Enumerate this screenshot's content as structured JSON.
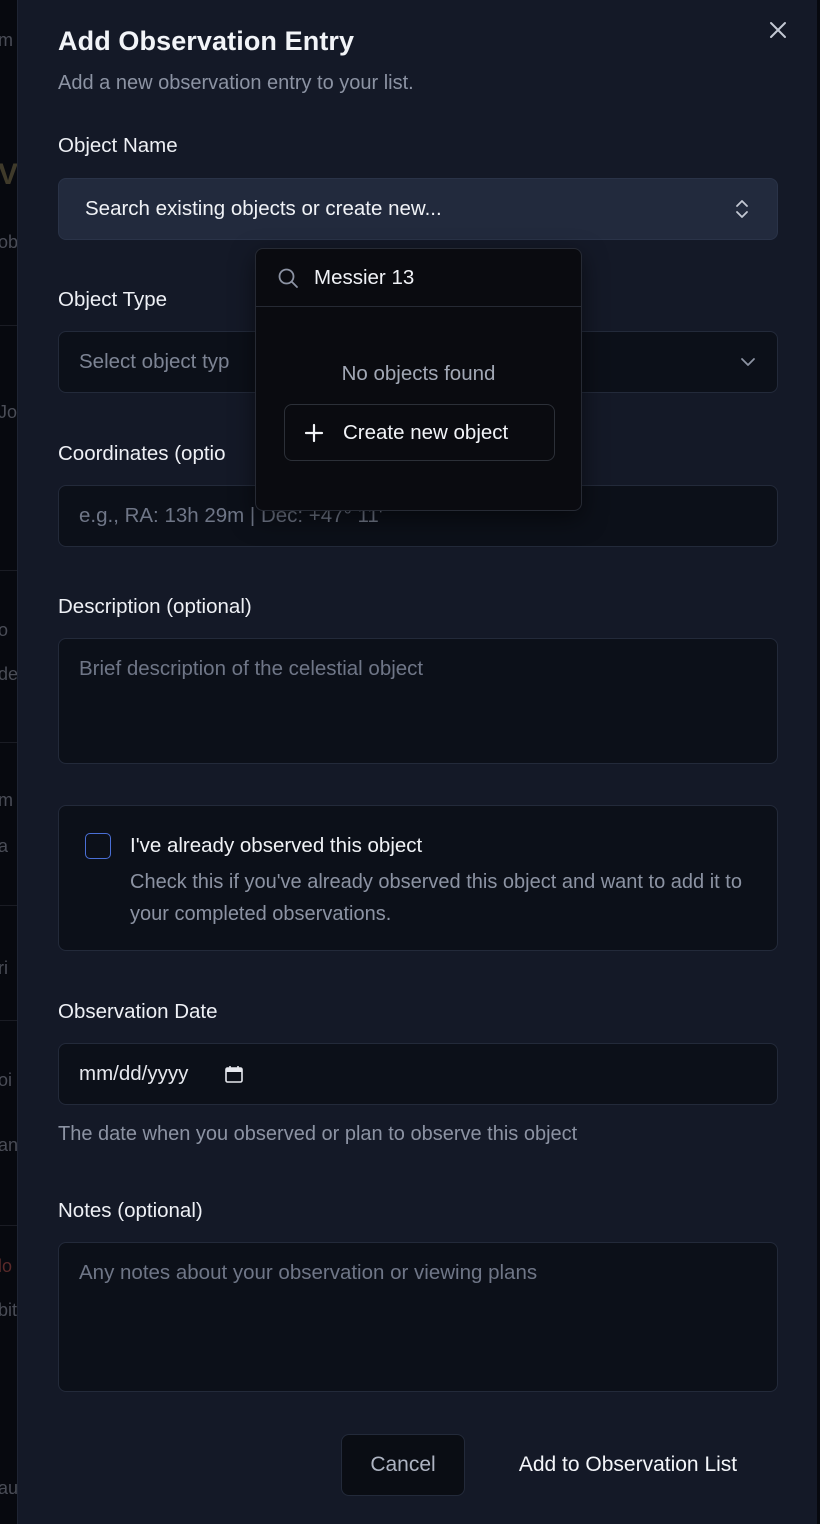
{
  "background": {
    "fragments": [
      "m",
      "Va",
      "ob",
      "Jo",
      "o",
      "de",
      "m",
      "a",
      "ri",
      "oi",
      "an",
      "lo",
      "bit",
      "au"
    ]
  },
  "modal": {
    "title": "Add Observation Entry",
    "subtitle": "Add a new observation entry to your list.",
    "object_name": {
      "label": "Object Name",
      "placeholder": "Search existing objects or create new..."
    },
    "object_type": {
      "label": "Object Type",
      "placeholder": "Select object typ"
    },
    "coordinates": {
      "label": "Coordinates (optio",
      "placeholder": "e.g., RA: 13h 29m | Dec: +47° 11'"
    },
    "description": {
      "label": "Description (optional)",
      "placeholder": "Brief description of the celestial object"
    },
    "observed": {
      "checked": false,
      "title": "I've already observed this object",
      "description": "Check this if you've already observed this object and want to add it to your completed observations."
    },
    "observation_date": {
      "label": "Observation Date",
      "value": "mm/dd/yyyy",
      "hint": "The date when you observed or plan to observe this object"
    },
    "notes": {
      "label": "Notes (optional)",
      "placeholder": "Any notes about your observation or viewing plans"
    },
    "buttons": {
      "cancel": "Cancel",
      "submit": "Add to Observation List"
    }
  },
  "popover": {
    "search_value": "Messier 13",
    "empty_text": "No objects found",
    "create_label": "Create new object"
  },
  "colors": {
    "modal_bg": "#141927",
    "combo_bg": "#222a3d",
    "field_bg": "#0c1019",
    "popover_bg": "#0a0b10",
    "checkbox_border": "#4a6fd6"
  }
}
